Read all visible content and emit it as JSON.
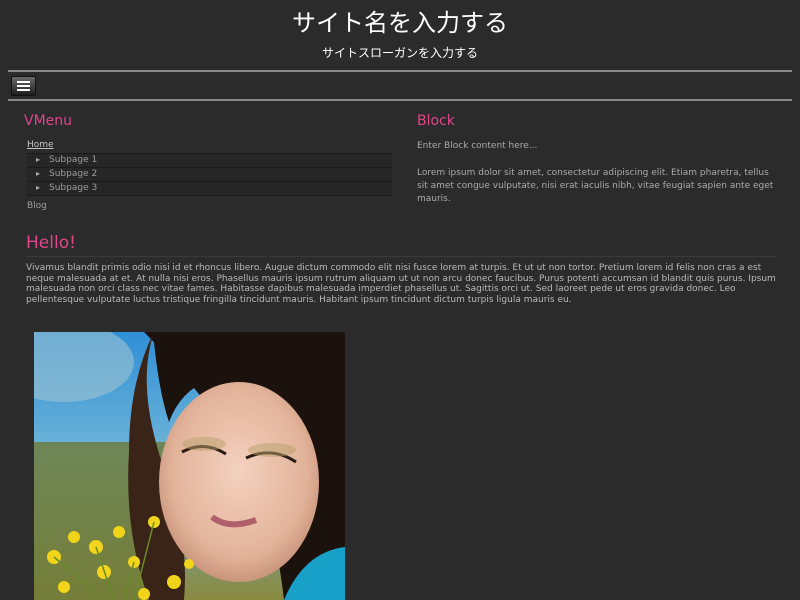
{
  "header": {
    "site_title": "サイト名を入力する",
    "site_slogan": "サイトスローガンを入力する"
  },
  "nav": {
    "menu_icon": "hamburger-icon"
  },
  "vmenu": {
    "title": "VMenu",
    "home": "Home",
    "subpages": [
      "Subpage 1",
      "Subpage 2",
      "Subpage 3"
    ],
    "blog": "Blog"
  },
  "block": {
    "title": "Block",
    "content": "Enter Block content here...",
    "lorem": "Lorem ipsum dolor sit amet, consectetur adipiscing elit. Etiam pharetra, tellus sit amet congue vulputate, nisi erat iaculis nibh, vitae feugiat sapien ante eget mauris."
  },
  "article": {
    "heading": "Hello!",
    "body": "Vivamus blandit primis odio nisi id et rhoncus libero. Augue dictum commodo elit nisi fusce lorem at turpis. Et ut ut non tortor. Pretium lorem id felis non cras a est neque malesuada at et. At nulla nisi eros. Phasellus mauris ipsum rutrum aliquam ut ut non arcu donec faucibus. Purus potenti accumsan id blandit quis purus. Ipsum malesuada non orci class nec vitae fames. Habitasse dapibus malesuada imperdiet phasellus ut. Sagittis orci ut. Sed laoreet pede ut eros gravida donec. Leo pellentesque vulputate luctus tristique fringilla tincidunt mauris. Habitant ipsum tincidunt dictum turpis ligula mauris eu."
  },
  "colors": {
    "accent": "#e0458a",
    "background": "#2b2b2b",
    "text": "#b9b9b9"
  }
}
